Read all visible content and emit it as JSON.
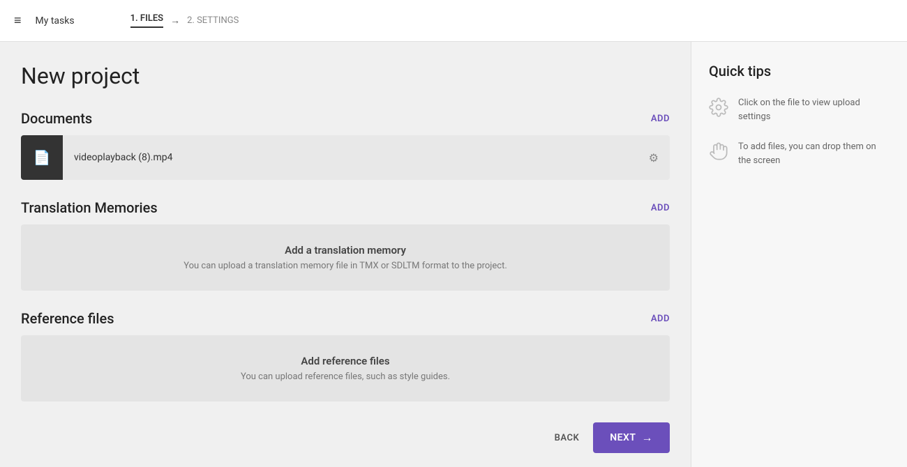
{
  "header": {
    "menu_icon": "≡",
    "my_tasks_label": "My tasks",
    "step1_label": "1. FILES",
    "arrow": "→",
    "step2_label": "2. SETTINGS"
  },
  "main": {
    "page_title": "New project",
    "documents": {
      "section_title": "Documents",
      "add_label": "ADD",
      "file": {
        "name": "videoplayback (8).mp4"
      }
    },
    "translation_memories": {
      "section_title": "Translation Memories",
      "add_label": "ADD",
      "empty_title": "Add a translation memory",
      "empty_subtitle": "You can upload a translation memory file in TMX or SDLTM format to the project."
    },
    "reference_files": {
      "section_title": "Reference files",
      "add_label": "ADD",
      "empty_title": "Add reference files",
      "empty_subtitle": "You can upload reference files, such as style guides."
    },
    "footer": {
      "back_label": "BACK",
      "next_label": "NEXT",
      "next_arrow": "→"
    }
  },
  "sidebar": {
    "title": "Quick tips",
    "tips": [
      {
        "text": "Click on the file to view upload settings"
      },
      {
        "text": "To add files, you can drop them on the screen"
      }
    ]
  }
}
